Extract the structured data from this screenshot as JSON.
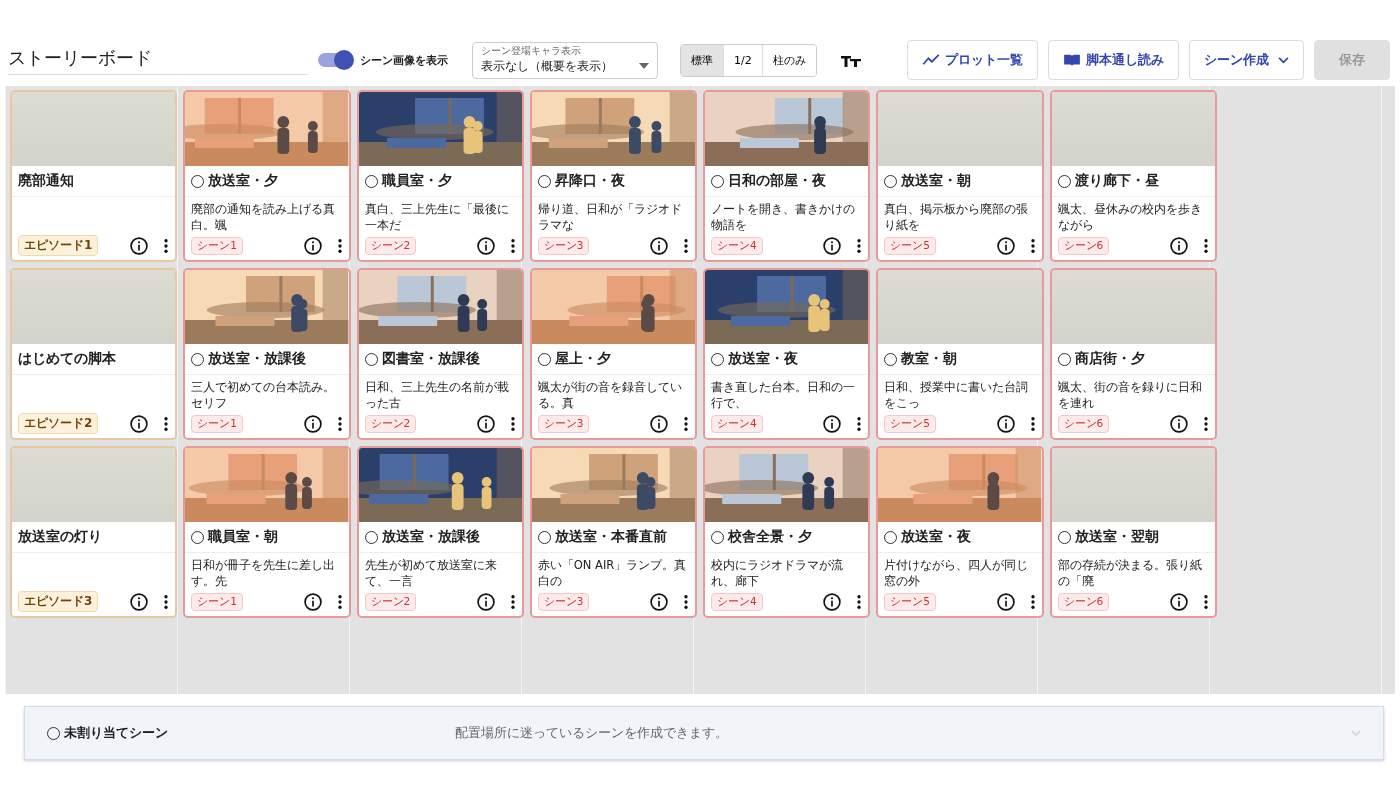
{
  "header": {
    "title": "ストーリーボード",
    "image_toggle": {
      "label": "シーン画像を表示",
      "on": true
    },
    "character_select": {
      "label": "シーン登場キャラ表示",
      "value": "表示なし（概要を表示）"
    },
    "view_modes": [
      {
        "label": "標準",
        "selected": true
      },
      {
        "label": "1/2",
        "selected": false
      },
      {
        "label": "柱のみ",
        "selected": false
      }
    ],
    "buttons": [
      {
        "kind": "plot",
        "label": "プロット一覧",
        "disabled": false
      },
      {
        "kind": "read",
        "label": "脚本通し読み",
        "disabled": false
      },
      {
        "kind": "create",
        "label": "シーン作成",
        "disabled": false
      },
      {
        "kind": "save",
        "label": "保存",
        "disabled": true
      }
    ]
  },
  "board": {
    "rows": [
      {
        "episode": {
          "title": "廃部通知",
          "badge": "エピソード1"
        },
        "scenes": [
          {
            "heading": "放送室・夕",
            "checked": false,
            "summary": "廃部の通知を読み上げる真白。颯",
            "badge": "シーン1"
          },
          {
            "heading": "職員室・夕",
            "checked": false,
            "summary": "真白、三上先生に「最後に一本だ",
            "badge": "シーン2"
          },
          {
            "heading": "昇降口・夜",
            "checked": false,
            "summary": "帰り道、日和が「ラジオドラマな",
            "badge": "シーン3"
          },
          {
            "heading": "日和の部屋・夜",
            "checked": false,
            "summary": "ノートを開き、書きかけの物語を",
            "badge": "シーン4"
          },
          {
            "heading": "放送室・朝",
            "checked": false,
            "summary": "真白、掲示板から廃部の張り紙を",
            "badge": "シーン5",
            "image": {
              "kind": "blank"
            }
          },
          {
            "heading": "渡り廊下・昼",
            "checked": false,
            "summary": "颯太、昼休みの校内を歩きながら",
            "badge": "シーン6",
            "image": {
              "kind": "blank"
            }
          }
        ]
      },
      {
        "episode": {
          "title": "はじめての脚本",
          "badge": "エピソード2"
        },
        "scenes": [
          {
            "heading": "放送室・放課後",
            "checked": false,
            "summary": "三人で初めての台本読み。セリフ",
            "badge": "シーン1"
          },
          {
            "heading": "図書室・放課後",
            "checked": false,
            "summary": "日和、三上先生の名前が載った古",
            "badge": "シーン2"
          },
          {
            "heading": "屋上・夕",
            "checked": false,
            "summary": "颯太が街の音を録音している。真",
            "badge": "シーン3"
          },
          {
            "heading": "放送室・夜",
            "checked": false,
            "summary": "書き直した台本。日和の一行で、",
            "badge": "シーン4"
          },
          {
            "heading": "教室・朝",
            "checked": false,
            "summary": "日和、授業中に書いた台詞をこっ",
            "badge": "シーン5",
            "image": {
              "kind": "blank"
            }
          },
          {
            "heading": "商店街・夕",
            "checked": false,
            "summary": "颯太、街の音を録りに日和を連れ",
            "badge": "シーン6",
            "image": {
              "kind": "blank"
            }
          }
        ]
      },
      {
        "episode": {
          "title": "放送室の灯り",
          "badge": "エピソード3"
        },
        "scenes": [
          {
            "heading": "職員室・朝",
            "checked": false,
            "summary": "日和が冊子を先生に差し出す。先",
            "badge": "シーン1"
          },
          {
            "heading": "放送室・放課後",
            "checked": false,
            "summary": "先生が初めて放送室に来て、一言",
            "badge": "シーン2"
          },
          {
            "heading": "放送室・本番直前",
            "checked": false,
            "summary": "赤い「ON AIR」ランプ。真白の",
            "badge": "シーン3"
          },
          {
            "heading": "校舎全景・夕",
            "checked": false,
            "summary": "校内にラジオドラマが流れ、廊下",
            "badge": "シーン4"
          },
          {
            "heading": "放送室・夜",
            "checked": false,
            "summary": "片付けながら、四人が同じ窓の外",
            "badge": "シーン5"
          },
          {
            "heading": "放送室・翌朝",
            "checked": false,
            "summary": "部の存続が決まる。張り紙の「廃",
            "badge": "シーン6",
            "image": {
              "kind": "blank"
            }
          }
        ]
      }
    ]
  },
  "unassigned": {
    "title": "未割り当てシーン",
    "checked": false,
    "hint": "配置場所に迷っているシーンを作成できます。"
  }
}
